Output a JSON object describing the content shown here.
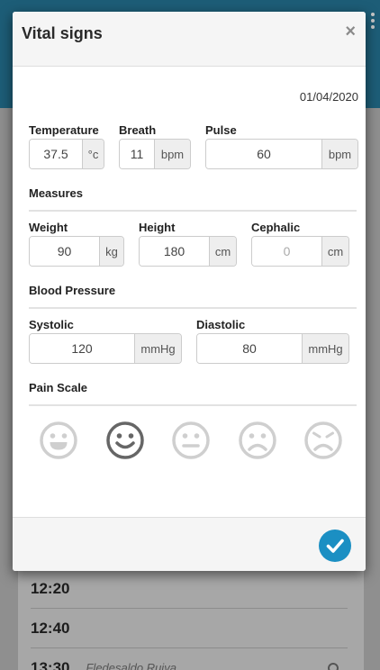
{
  "modal": {
    "title": "Vital signs",
    "close_symbol": "×",
    "date": "01/04/2020",
    "confirm_icon": "check-circle-icon"
  },
  "vitals": {
    "temperature": {
      "label": "Temperature",
      "value": "37.5",
      "unit": "°c"
    },
    "breath": {
      "label": "Breath",
      "value": "11",
      "unit": "bpm"
    },
    "pulse": {
      "label": "Pulse",
      "value": "60",
      "unit": "bpm"
    }
  },
  "measures": {
    "section_title": "Measures",
    "weight": {
      "label": "Weight",
      "value": "90",
      "unit": "kg"
    },
    "height": {
      "label": "Height",
      "value": "180",
      "unit": "cm"
    },
    "cephalic": {
      "label": "Cephalic",
      "value": "",
      "placeholder": "0",
      "unit": "cm"
    }
  },
  "blood_pressure": {
    "section_title": "Blood Pressure",
    "systolic": {
      "label": "Systolic",
      "value": "120",
      "unit": "mmHg"
    },
    "diastolic": {
      "label": "Diastolic",
      "value": "80",
      "unit": "mmHg"
    }
  },
  "pain_scale": {
    "section_title": "Pain Scale",
    "faces": [
      "grin-face-icon",
      "smile-face-icon",
      "neutral-face-icon",
      "frown-face-icon",
      "sad-face-icon"
    ],
    "selected_index": 1
  },
  "background": {
    "rows": [
      {
        "time": "12:20",
        "name": ""
      },
      {
        "time": "12:40",
        "name": ""
      },
      {
        "time": "13:30",
        "name": "Fledesaldo Ruiva"
      }
    ]
  },
  "colors": {
    "header_bg": "#1d5d77",
    "accent": "#1b8fc3",
    "face_selected": "#666666",
    "face_default": "#cfcfcf"
  }
}
